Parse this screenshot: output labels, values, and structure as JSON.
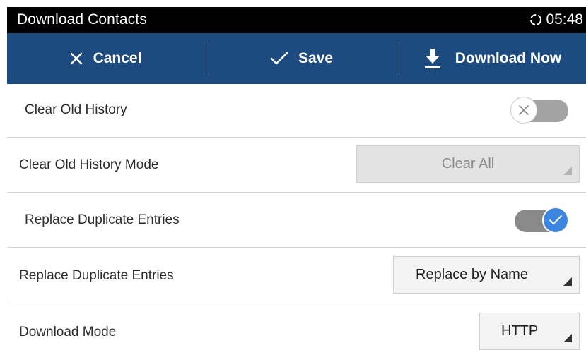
{
  "status_bar": {
    "title": "Download Contacts",
    "time": "05:48",
    "sync_icon": "sync-icon"
  },
  "action_bar": {
    "cancel": {
      "label": "Cancel",
      "icon": "close-icon"
    },
    "save": {
      "label": "Save",
      "icon": "check-icon"
    },
    "download": {
      "label": "Download Now",
      "icon": "download-icon"
    }
  },
  "settings": {
    "clear_old_history": {
      "label": "Clear Old History",
      "enabled": false
    },
    "clear_old_history_mode": {
      "label": "Clear Old History Mode",
      "value": "Clear All",
      "disabled": true
    },
    "replace_duplicate_toggle": {
      "label": "Replace Duplicate Entries",
      "enabled": true
    },
    "replace_duplicate_mode": {
      "label": "Replace Duplicate Entries",
      "value": "Replace by Name"
    },
    "download_mode": {
      "label": "Download Mode",
      "value": "HTTP"
    }
  },
  "colors": {
    "status_bar_bg": "#000000",
    "action_bar_bg": "#1d4b7f",
    "toggle_on_knob": "#3d86e0",
    "divider": "#d4d4d4"
  }
}
